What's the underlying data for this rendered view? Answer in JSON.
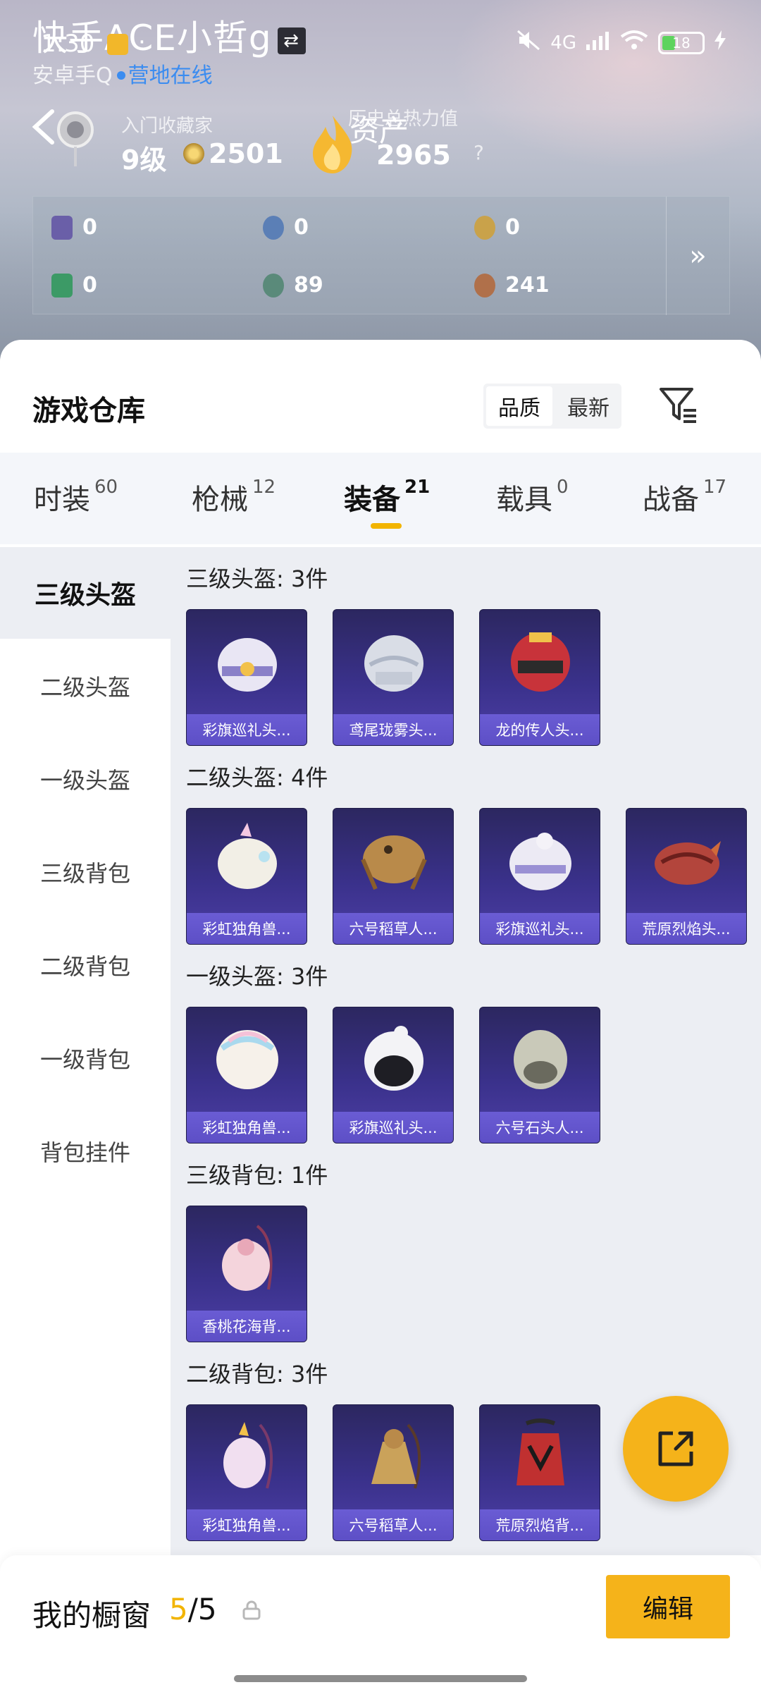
{
  "status_bar": {
    "time": "1:30",
    "dots": "·",
    "network": "4G",
    "battery": "18"
  },
  "profile": {
    "name": "快手ACE小哲g",
    "switch_icon": "⇄",
    "platform": "安卓手Q",
    "online_status": "营地在线",
    "rank_title": "入门收藏家",
    "level": "9级",
    "coins": "2501",
    "asset_label": "资产",
    "heat_label": "历史总热力值",
    "heat_value": "2965",
    "heat_help": "?"
  },
  "stats": [
    {
      "icon": "card-icon",
      "value": "0",
      "color": "#6a5fa8"
    },
    {
      "icon": "badge-icon",
      "value": "0",
      "color": "#5b7fb6"
    },
    {
      "icon": "medal-icon",
      "value": "0",
      "color": "#c9a24a"
    },
    {
      "icon": "green-card-icon",
      "value": "0",
      "color": "#3c9a66"
    },
    {
      "icon": "orb-icon",
      "value": "89",
      "color": "#5a8a7a"
    },
    {
      "icon": "bronze-icon",
      "value": "241",
      "color": "#b0704a"
    }
  ],
  "stats_more": "»",
  "warehouse": {
    "title": "游戏仓库",
    "sort_options": [
      "品质",
      "最新"
    ],
    "sort_active": 0
  },
  "tabs": [
    {
      "label": "时装",
      "count": "60"
    },
    {
      "label": "枪械",
      "count": "12"
    },
    {
      "label": "装备",
      "count": "21"
    },
    {
      "label": "载具",
      "count": "0"
    },
    {
      "label": "战备",
      "count": "17"
    }
  ],
  "active_tab": 2,
  "sidebar": [
    "三级头盔",
    "二级头盔",
    "一级头盔",
    "三级背包",
    "二级背包",
    "一级背包",
    "背包挂件"
  ],
  "sections": [
    {
      "title": "三级头盔: 3件",
      "items": [
        {
          "name": "彩旗巡礼头...",
          "color": "#e9e6f4"
        },
        {
          "name": "鸢尾珑雾头...",
          "color": "#d9dde6"
        },
        {
          "name": "龙的传人头...",
          "color": "#c8333a"
        }
      ]
    },
    {
      "title": "二级头盔: 4件",
      "items": [
        {
          "name": "彩虹独角兽...",
          "color": "#f2efe6"
        },
        {
          "name": "六号稻草人...",
          "color": "#b98a4a"
        },
        {
          "name": "彩旗巡礼头...",
          "color": "#eceaf4"
        },
        {
          "name": "荒原烈焰头...",
          "color": "#b3453c"
        }
      ]
    },
    {
      "title": "一级头盔: 3件",
      "items": [
        {
          "name": "彩虹独角兽...",
          "color": "#f6f1ea"
        },
        {
          "name": "彩旗巡礼头...",
          "color": "#f3f3f6"
        },
        {
          "name": "六号石头人...",
          "color": "#c9c9b9"
        }
      ]
    },
    {
      "title": "三级背包: 1件",
      "items": [
        {
          "name": "香桃花海背...",
          "color": "#f4d4dc"
        }
      ]
    },
    {
      "title": "二级背包: 3件",
      "items": [
        {
          "name": "彩虹独角兽...",
          "color": "#f1dff0"
        },
        {
          "name": "六号稻草人...",
          "color": "#caa25a"
        },
        {
          "name": "荒原烈焰背...",
          "color": "#c03030"
        }
      ]
    }
  ],
  "showcase": {
    "label": "我的橱窗",
    "used": "5",
    "total": "/5",
    "edit": "编辑"
  },
  "colors": {
    "accent": "#f5b31a",
    "card_bg": "#3a318b",
    "card_label": "#6a5cd4",
    "online": "#3b8cf0"
  }
}
